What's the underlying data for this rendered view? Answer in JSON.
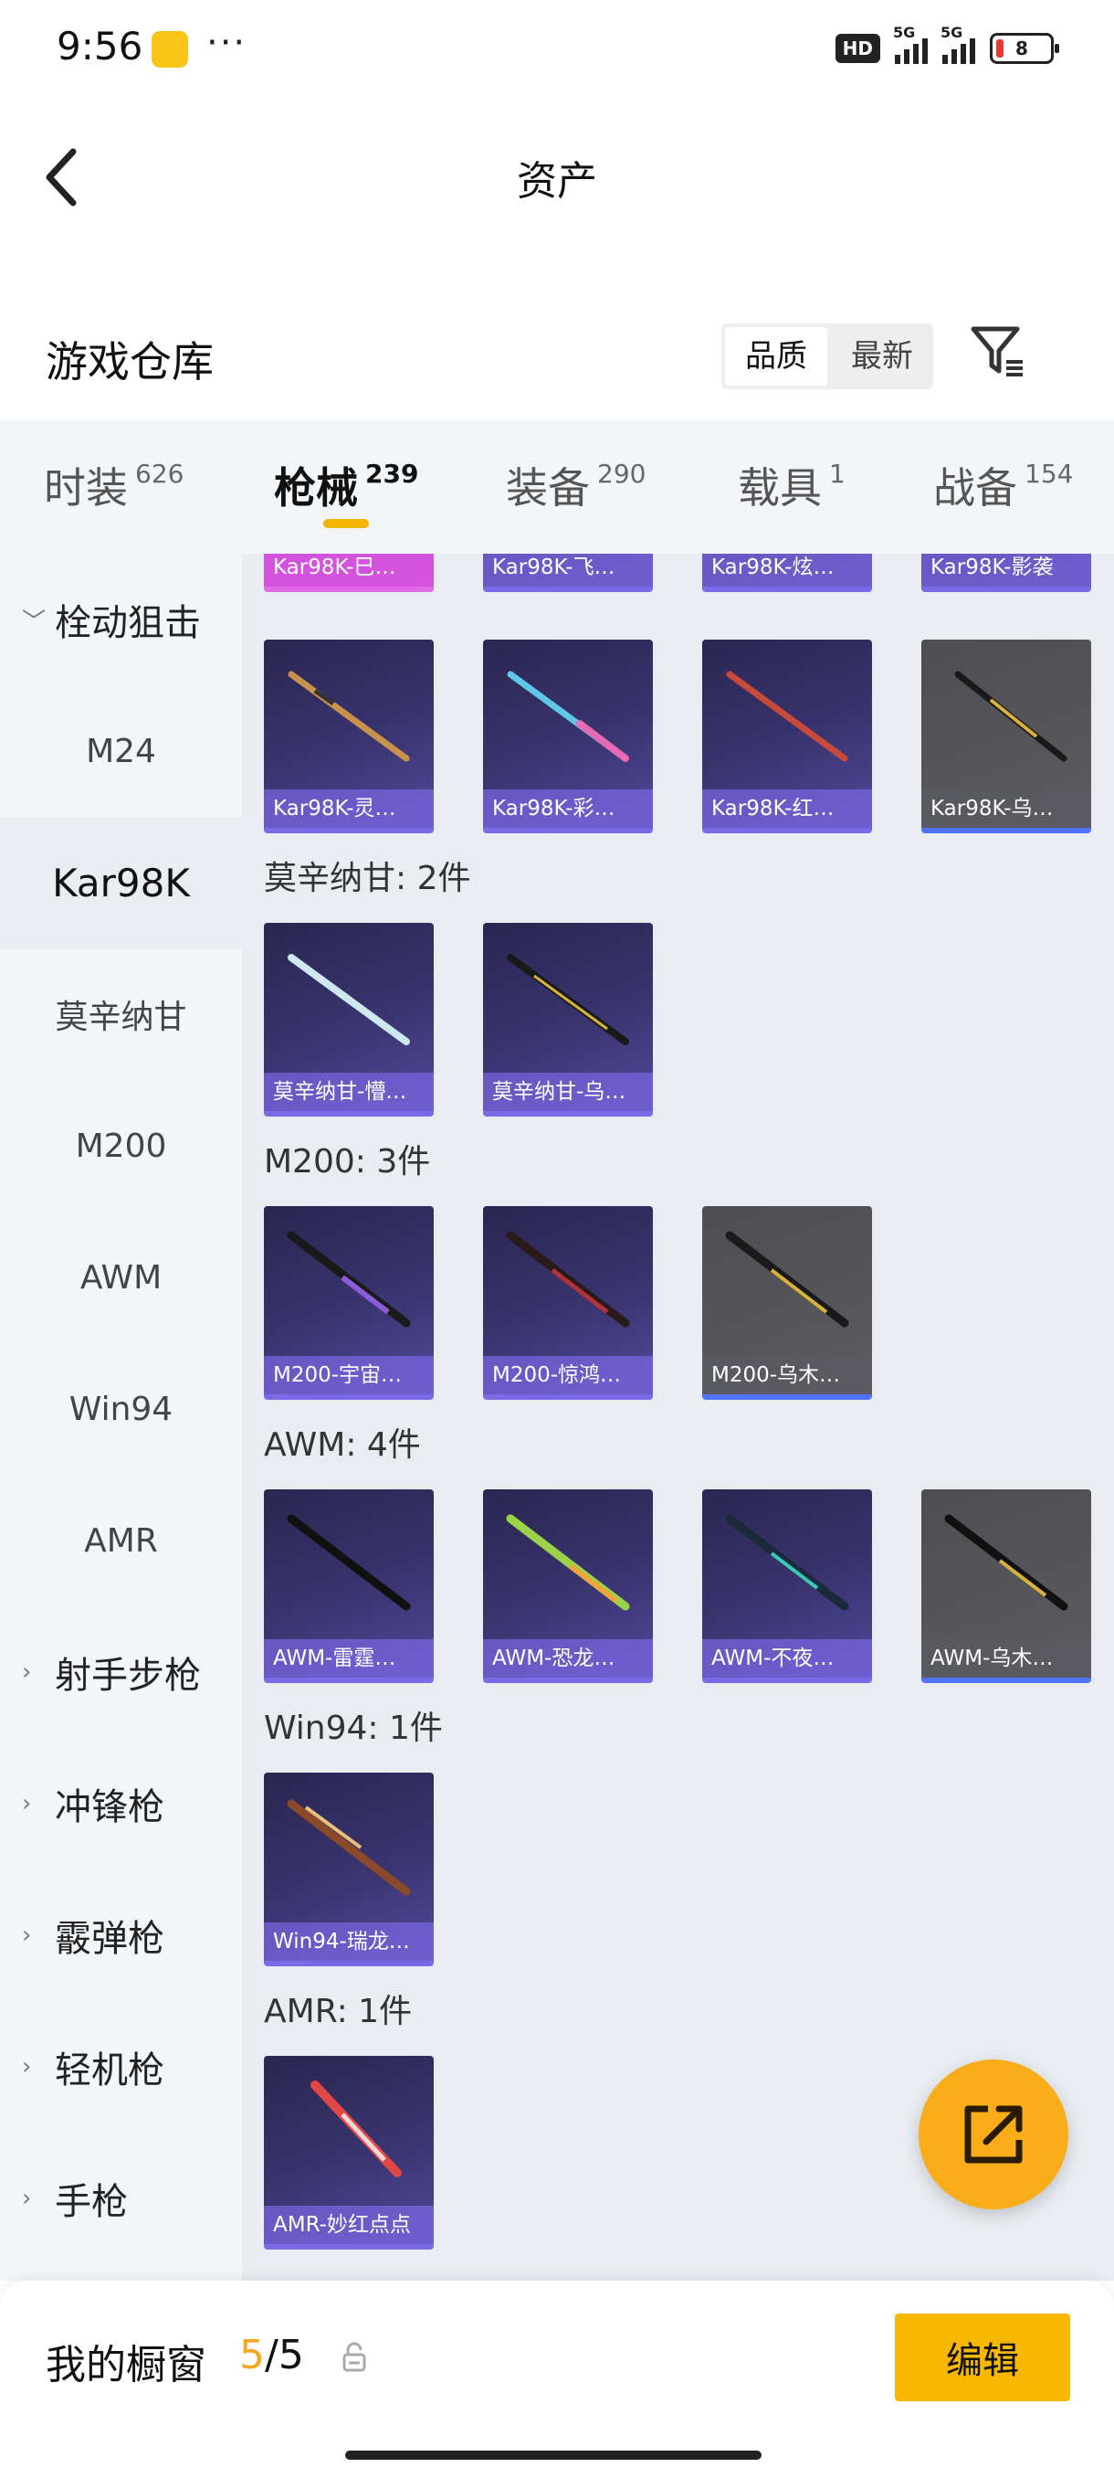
{
  "status_bar": {
    "time": "9:56",
    "dots": "···",
    "hd": "HD",
    "network": "5G",
    "battery": "8"
  },
  "header": {
    "title": "资产"
  },
  "section": {
    "title": "游戏仓库",
    "sort_options": [
      "品质",
      "最新"
    ]
  },
  "tabs": [
    {
      "label": "时装",
      "count": "626"
    },
    {
      "label": "枪械",
      "count": "239"
    },
    {
      "label": "装备",
      "count": "290"
    },
    {
      "label": "载具",
      "count": "1"
    },
    {
      "label": "战备",
      "count": "154"
    }
  ],
  "sidebar": {
    "group_open": "栓动狙击",
    "subitems": [
      "M24",
      "Kar98K",
      "莫辛纳甘",
      "M200",
      "AWM",
      "Win94",
      "AMR"
    ],
    "groups": [
      "射手步枪",
      "冲锋枪",
      "霰弹枪",
      "轻机枪",
      "手枪"
    ]
  },
  "content": {
    "partial_row": [
      "Kar98K-巳…",
      "Kar98K-飞…",
      "Kar98K-炫…",
      "Kar98K-影袭"
    ],
    "kar_row": [
      "Kar98K-灵…",
      "Kar98K-彩…",
      "Kar98K-红…",
      "Kar98K-乌…"
    ],
    "mosin_label": "莫辛纳甘: 2件",
    "mosin_row": [
      "莫辛纳甘-懵…",
      "莫辛纳甘-乌…"
    ],
    "m200_label": "M200: 3件",
    "m200_row": [
      "M200-宇宙…",
      "M200-惊鸿…",
      "M200-乌木…"
    ],
    "awm_label": "AWM: 4件",
    "awm_row": [
      "AWM-雷霆…",
      "AWM-恐龙…",
      "AWM-不夜…",
      "AWM-乌木…"
    ],
    "win94_label": "Win94: 1件",
    "win94_row": [
      "Win94-瑞龙…"
    ],
    "amr_label": "AMR: 1件",
    "amr_row": [
      "AMR-妙红点点"
    ]
  },
  "bottom": {
    "title": "我的橱窗",
    "current": "5",
    "total": "/5",
    "edit_label": "编辑"
  },
  "colors": {
    "accent": "#f8b800",
    "card_purple": "#3a3470",
    "card_gray": "#5b5b60",
    "tab_underline": "#f5b301"
  }
}
